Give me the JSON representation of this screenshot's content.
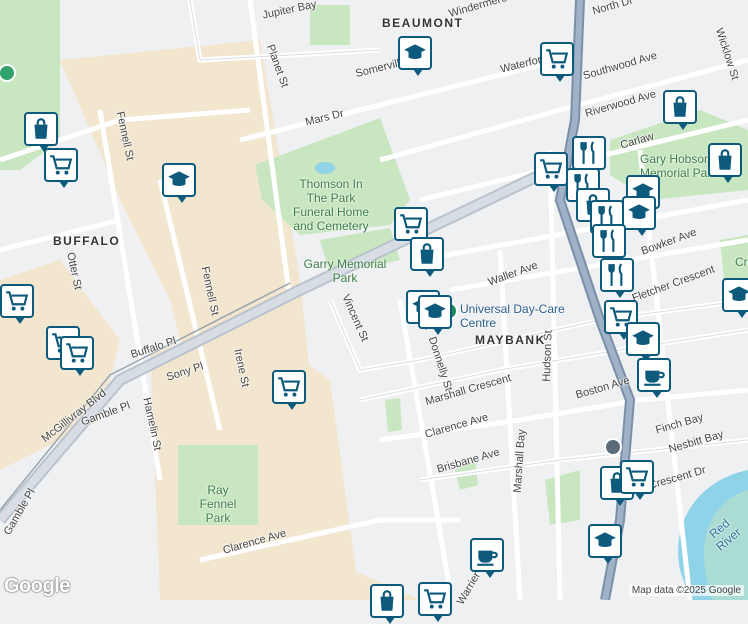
{
  "map": {
    "neighbourhoods": [
      "BEAUMONT",
      "BUFFALO",
      "MAYBANK"
    ],
    "streets": [
      "Jupiter Bay",
      "Windermere",
      "North Dr",
      "Wicklow St",
      "Planet St",
      "Somerville",
      "Waterford",
      "Southwood Ave",
      "Riverwood Ave",
      "Mars Dr",
      "Fennell St",
      "Carlaw",
      "Gary Hobson",
      "Otter St",
      "Fennell St",
      "Bowker Ave",
      "Waller Ave",
      "Fletcher Crescent",
      "Buffalo Pl",
      "Vincent St",
      "Sony Pl",
      "Irene St",
      "Donnelly St",
      "Hudson St",
      "McGillivray Blvd",
      "Gamble Pl",
      "Hamelin St",
      "Marshall Crescent",
      "Boston Ave",
      "Clarence Ave",
      "Finch Bay",
      "Nesbitt Bay",
      "Brisbane Ave",
      "Marshall Bay",
      "Crescent Dr",
      "Clarence Ave",
      "Gamble Pl",
      "Warrier Blvd"
    ],
    "parks": [
      "Thomson In The Park Funeral Home and Cemetery",
      "Garry Memorial Park",
      "Ray Fennel Park",
      "Gary Hobson Memorial Park",
      "Red River",
      "Cre"
    ],
    "poi_labels": [
      "Universal Day-Care Centre"
    ],
    "attribution": "Map data ©2025 Google",
    "logo": "Google"
  },
  "icons": {
    "shopping_cart": "cart-icon",
    "shopping_bag": "bag-icon",
    "school": "school-icon",
    "restaurant": "restaurant-icon",
    "cafe": "cafe-icon"
  },
  "colors": {
    "pin_border": "#0e5a7c",
    "park": "#c8e6c0",
    "industrial": "#f2e6cf",
    "water": "#8fd3e8",
    "highway": "#9aa8b6"
  }
}
